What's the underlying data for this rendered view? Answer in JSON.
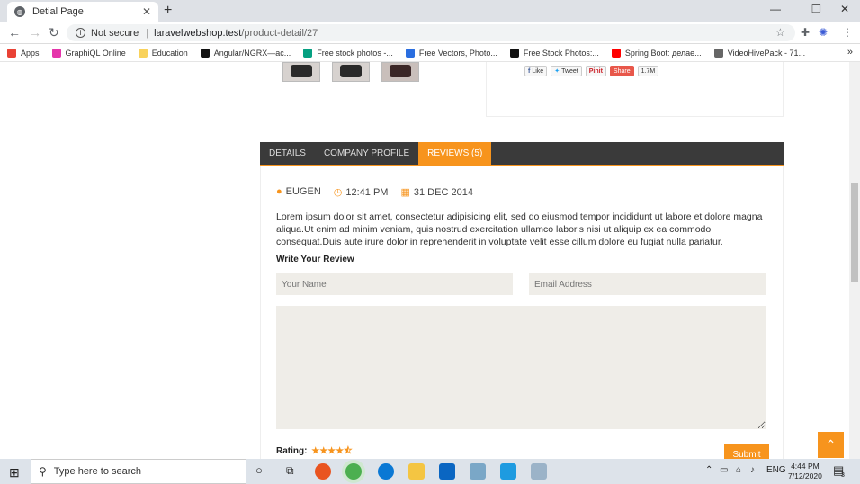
{
  "browser": {
    "tab_title": "Detial Page",
    "tab_close": "✕",
    "new_tab": "+",
    "window_controls": [
      "—",
      "❐",
      "✕"
    ],
    "not_secure": "Not secure",
    "url_host": "laravelwebshop.test",
    "url_path": "/product-detail/27",
    "bookmarks": [
      {
        "label": "Apps",
        "color": "#e94235"
      },
      {
        "label": "GraphiQL Online",
        "color": "#e535ab"
      },
      {
        "label": "Education",
        "color": "#f9d25b"
      },
      {
        "label": "Angular/NGRX—ac...",
        "color": "#111111"
      },
      {
        "label": "Free stock photos -...",
        "color": "#05a081"
      },
      {
        "label": "Free Vectors, Photo...",
        "color": "#2a6ee0"
      },
      {
        "label": "Free Stock Photos:...",
        "color": "#111111"
      },
      {
        "label": "Spring Boot: делае...",
        "color": "#ff0000"
      },
      {
        "label": "VideoHivePack - 71...",
        "color": "#666666"
      }
    ],
    "bookmarks_more": "»"
  },
  "social": {
    "like": "Like",
    "tweet": "Tweet",
    "pinit": "Pinit",
    "share": "Share",
    "count": "1.7M"
  },
  "tabs": [
    {
      "label": "DETAILS",
      "active": false
    },
    {
      "label": "COMPANY PROFILE",
      "active": false
    },
    {
      "label": "REVIEWS (5)",
      "active": true
    }
  ],
  "review": {
    "author": "EUGEN",
    "time": "12:41 PM",
    "date": "31 DEC 2014",
    "text": "Lorem ipsum dolor sit amet, consectetur adipisicing elit, sed do eiusmod tempor incididunt ut labore et dolore magna aliqua.Ut enim ad minim veniam, quis nostrud exercitation ullamco laboris nisi ut aliquip ex ea commodo consequat.Duis aute irure dolor in reprehenderit in voluptate velit esse cillum dolore eu fugiat nulla pariatur."
  },
  "form": {
    "heading": "Write Your Review",
    "name_placeholder": "Your Name",
    "email_placeholder": "Email Address",
    "rating_label": "Rating:",
    "stars": "★★★★⯪",
    "rating_value": 4.5,
    "submit": "Submit"
  },
  "back_to_top": "⌃",
  "taskbar": {
    "search_placeholder": "Type here to search",
    "lang": "ENG",
    "time": "4:44 PM",
    "date": "7/12/2020",
    "notifications": "3"
  },
  "colors": {
    "accent": "#f7941d",
    "tab_bg": "#3a3a3a"
  }
}
